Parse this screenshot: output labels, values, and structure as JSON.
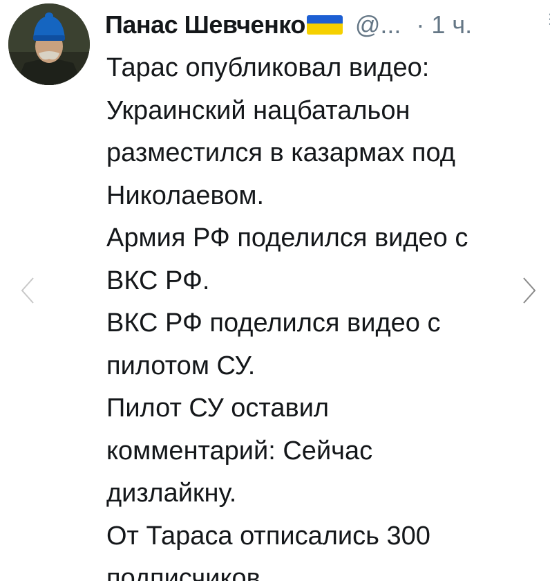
{
  "tweet": {
    "display_name": "Панас Шевченко",
    "handle": "@...",
    "time": "· 1 ч.",
    "flag_colors": {
      "top": "#1d5fd3",
      "bottom": "#f5d000"
    },
    "lines": [
      "Тарас опубликовал видео:",
      "Украинский нацбатальон",
      "разместился в казармах под",
      "Николаевом.",
      "Армия РФ поделился видео с",
      "ВКС РФ.",
      "ВКС РФ поделился видео с",
      "пилотом СУ.",
      "Пилот СУ оставил",
      "комментарий: Сейчас",
      "дизлайкну.",
      "От Тараса отписались 300",
      "подписчиков."
    ]
  },
  "icons": {
    "prev": "chevron-left-icon",
    "next": "chevron-right-icon",
    "flag": "ukraine-flag-icon",
    "more": "more-dots-icon"
  }
}
